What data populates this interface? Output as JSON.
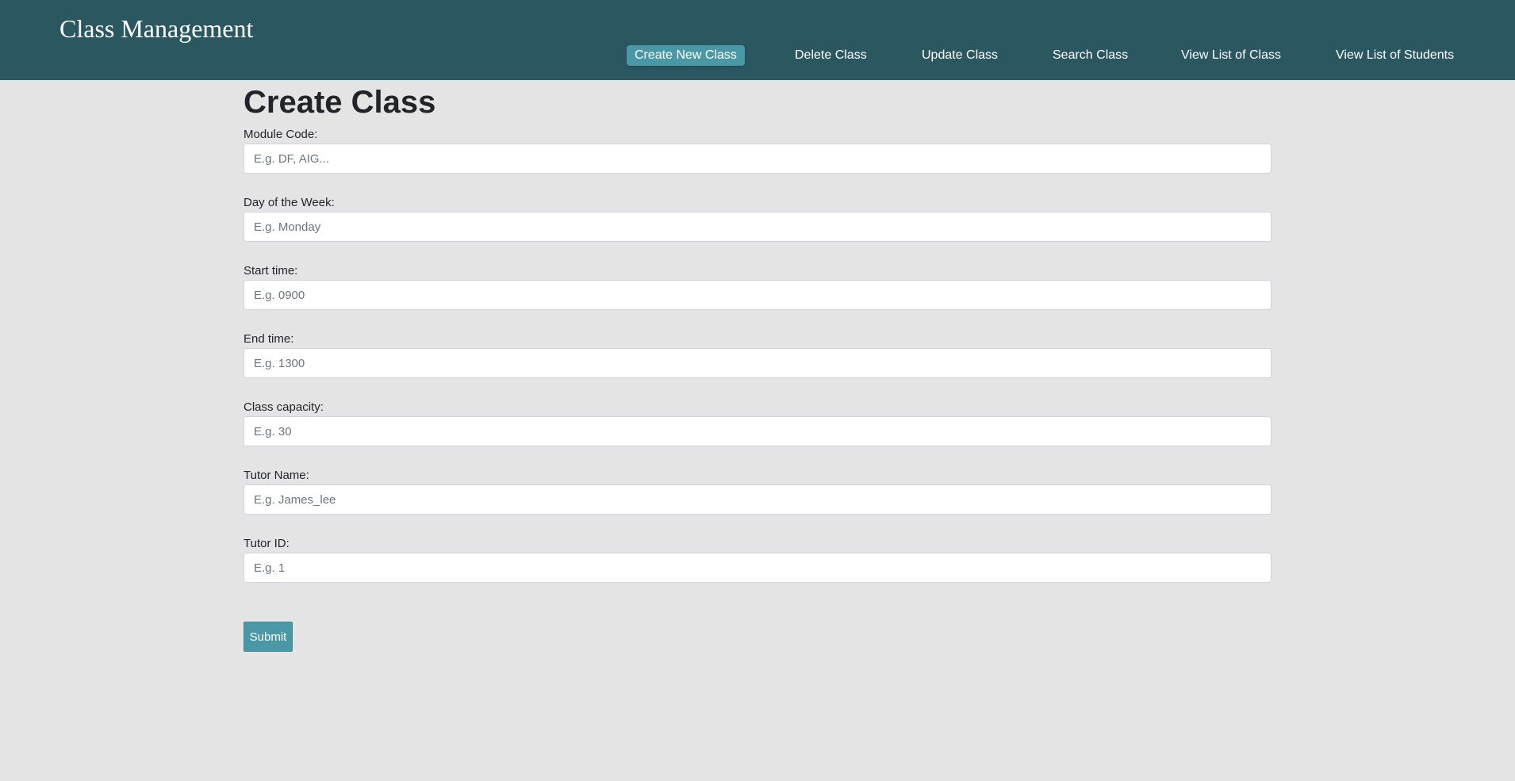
{
  "header": {
    "brand": "Class Management",
    "nav": [
      {
        "label": "Create New Class",
        "active": true
      },
      {
        "label": "Delete Class",
        "active": false
      },
      {
        "label": "Update Class",
        "active": false
      },
      {
        "label": "Search Class",
        "active": false
      },
      {
        "label": "View List of Class",
        "active": false
      },
      {
        "label": "View List of Students",
        "active": false
      }
    ]
  },
  "main": {
    "title": "Create Class",
    "fields": [
      {
        "label": "Module Code:",
        "placeholder": "E.g. DF, AIG...",
        "value": ""
      },
      {
        "label": "Day of the Week:",
        "placeholder": "E.g. Monday",
        "value": ""
      },
      {
        "label": "Start time:",
        "placeholder": "E.g. 0900",
        "value": ""
      },
      {
        "label": "End time:",
        "placeholder": "E.g. 1300",
        "value": ""
      },
      {
        "label": "Class capacity:",
        "placeholder": "E.g. 30",
        "value": ""
      },
      {
        "label": "Tutor Name:",
        "placeholder": "E.g. James_lee",
        "value": ""
      },
      {
        "label": "Tutor ID:",
        "placeholder": "E.g. 1",
        "value": ""
      }
    ],
    "submit_label": "Submit"
  },
  "colors": {
    "navbar": "#2b5761",
    "accent": "#4a98a6",
    "background": "#e4e4e4"
  }
}
